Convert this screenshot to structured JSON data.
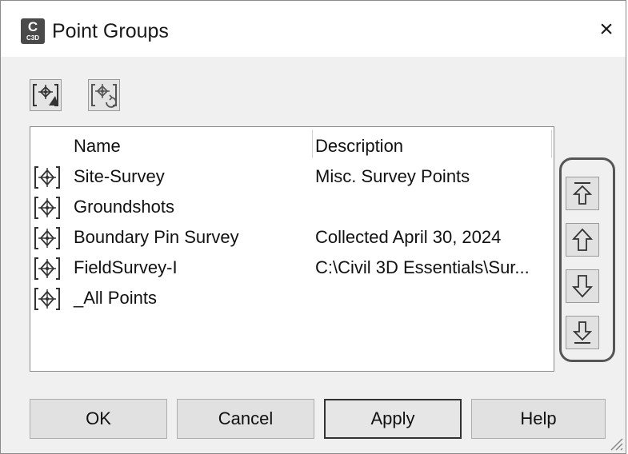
{
  "window": {
    "title": "Point Groups",
    "app_icon": {
      "letter": "C",
      "sublabel": "C3D"
    },
    "close_label": "×"
  },
  "toolbar": [
    {
      "name": "create-point-group",
      "icon": "point-group-create-icon"
    },
    {
      "name": "update-point-groups",
      "icon": "point-group-update-icon"
    }
  ],
  "list": {
    "headers": {
      "name": "Name",
      "description": "Description"
    },
    "rows": [
      {
        "name": "Site-Survey",
        "description": "Misc. Survey Points"
      },
      {
        "name": "Groundshots",
        "description": ""
      },
      {
        "name": "Boundary Pin Survey",
        "description": "Collected April 30, 2024"
      },
      {
        "name": "FieldSurvey-I",
        "description": "C:\\Civil 3D Essentials\\Sur..."
      },
      {
        "name": "_All Points",
        "description": ""
      }
    ]
  },
  "order_buttons": [
    {
      "name": "move-to-top",
      "icon": "arrow-to-top-icon"
    },
    {
      "name": "move-up",
      "icon": "arrow-up-icon"
    },
    {
      "name": "move-down",
      "icon": "arrow-down-icon"
    },
    {
      "name": "move-to-bottom",
      "icon": "arrow-to-bottom-icon"
    }
  ],
  "buttons": {
    "ok": "OK",
    "cancel": "Cancel",
    "apply": "Apply",
    "help": "Help"
  },
  "colors": {
    "dialog_bg": "#f0f0f0",
    "highlight_ring": "#555555"
  }
}
